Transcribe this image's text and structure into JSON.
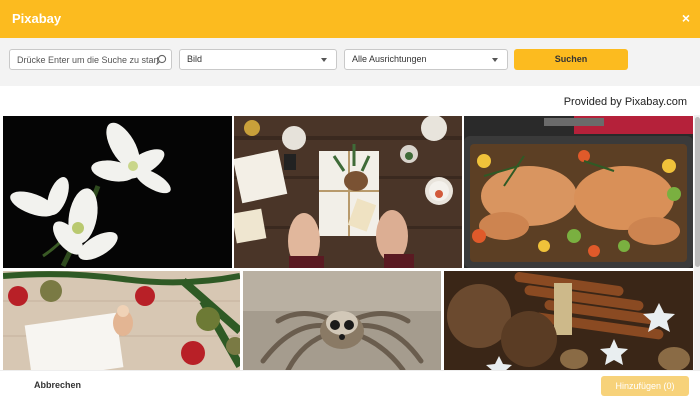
{
  "header": {
    "title": "Pixabay",
    "close_label": "×"
  },
  "search": {
    "placeholder": "Drücke Enter um die Suche zu starten",
    "type_value": "Bild",
    "orientation_value": "Alle Ausrichtungen",
    "button_label": "Suchen"
  },
  "provided_by": "Provided by Pixabay.com",
  "images": [
    {
      "subject": "white amaryllis on black"
    },
    {
      "subject": "hands holding christmas gift"
    },
    {
      "subject": "roasted chicken with vegetables"
    },
    {
      "subject": "christmas card with ornaments"
    },
    {
      "subject": "jumping spider"
    },
    {
      "subject": "cinnamon, pine cones and stars"
    }
  ],
  "footer": {
    "cancel_label": "Abbrechen",
    "add_label": "Hinzufügen (0)"
  },
  "colors": {
    "brand": "#fcbb1f",
    "button_disabled": "#f7d27a"
  }
}
